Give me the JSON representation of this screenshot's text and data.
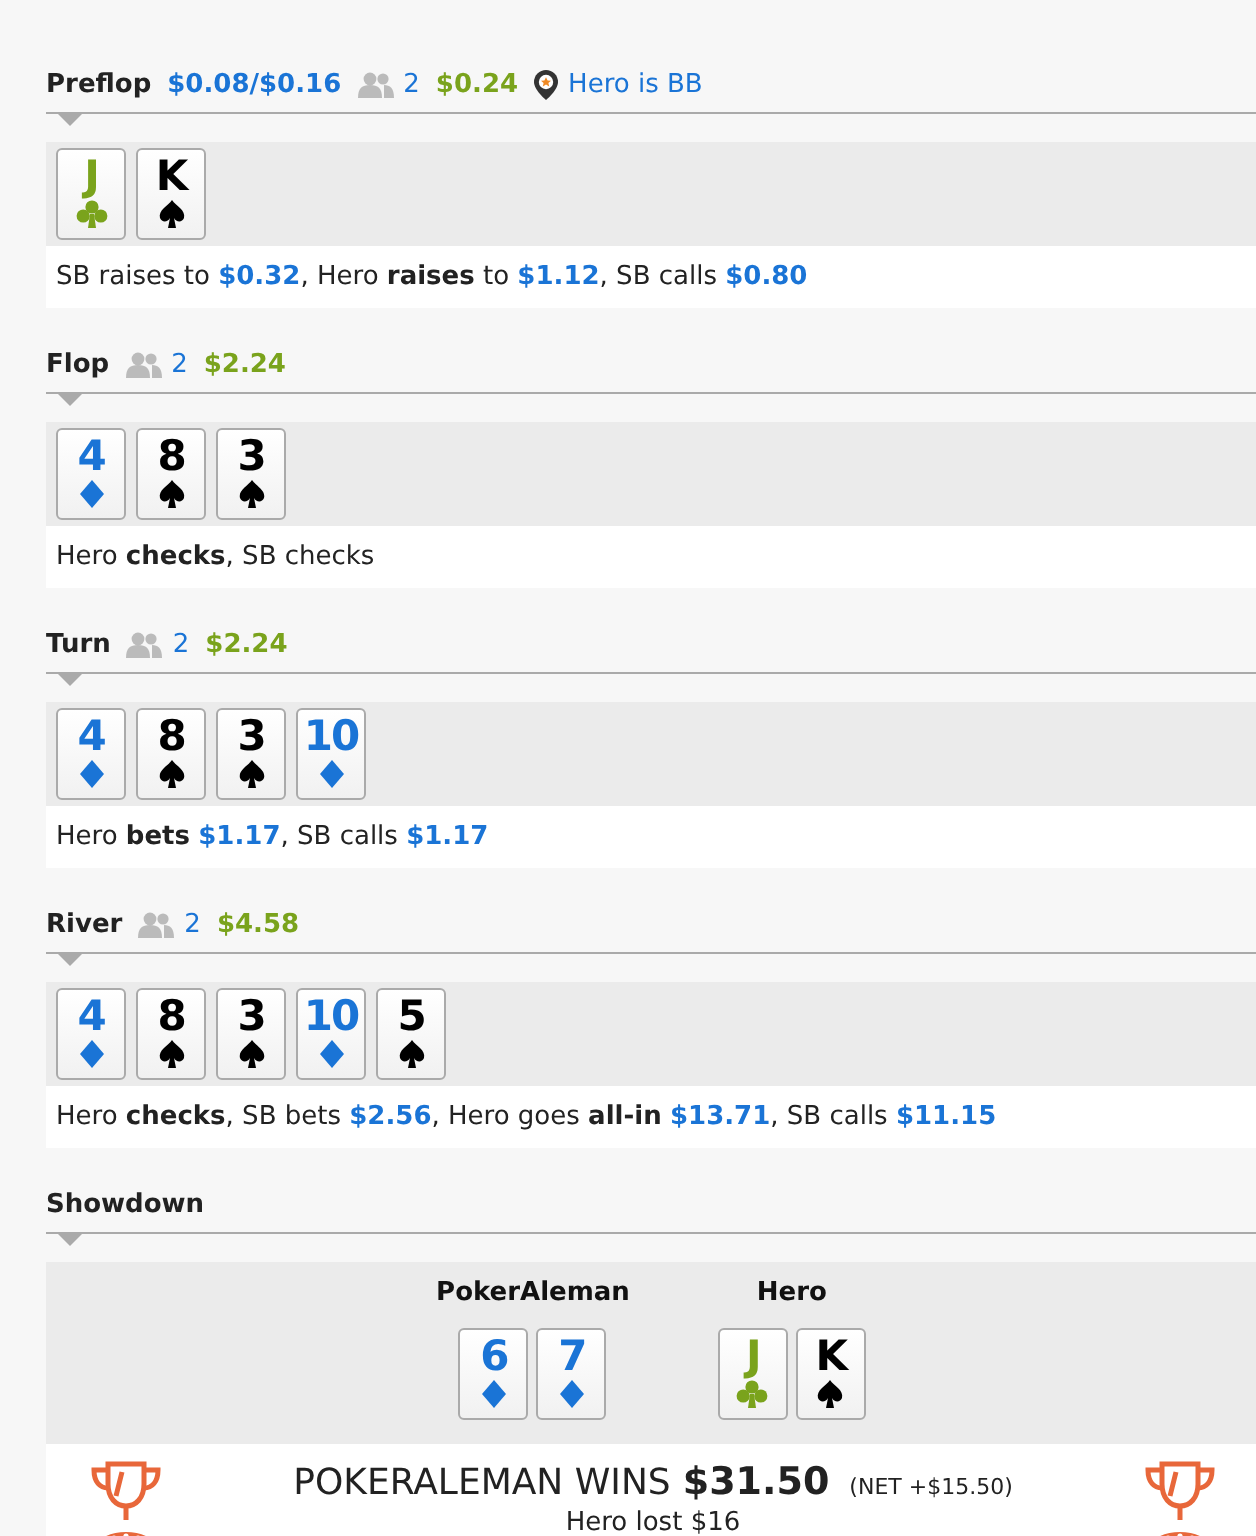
{
  "streets": [
    {
      "name": "Preflop",
      "blinds": "$0.08/$0.16",
      "players": "2",
      "pot": "$0.24",
      "position": "Hero is BB",
      "cards": [
        {
          "rank": "J",
          "kind": "clubs"
        },
        {
          "rank": "K",
          "kind": "spades"
        }
      ],
      "action": [
        {
          "kind": "plain",
          "text": "SB raises to "
        },
        {
          "kind": "amount",
          "text": "$0.32"
        },
        {
          "kind": "plain",
          "text": ", Hero "
        },
        {
          "kind": "verb",
          "text": "raises"
        },
        {
          "kind": "plain",
          "text": " to "
        },
        {
          "kind": "amount",
          "text": "$1.12"
        },
        {
          "kind": "plain",
          "text": ", SB calls "
        },
        {
          "kind": "amount",
          "text": "$0.80"
        }
      ]
    },
    {
      "name": "Flop",
      "players": "2",
      "pot": "$2.24",
      "cards": [
        {
          "rank": "4",
          "kind": "diamonds"
        },
        {
          "rank": "8",
          "kind": "spades"
        },
        {
          "rank": "3",
          "kind": "spades"
        }
      ],
      "action": [
        {
          "kind": "plain",
          "text": "Hero "
        },
        {
          "kind": "verb",
          "text": "checks"
        },
        {
          "kind": "plain",
          "text": ", SB checks"
        }
      ]
    },
    {
      "name": "Turn",
      "players": "2",
      "pot": "$2.24",
      "cards": [
        {
          "rank": "4",
          "kind": "diamonds"
        },
        {
          "rank": "8",
          "kind": "spades"
        },
        {
          "rank": "3",
          "kind": "spades"
        },
        {
          "rank": "10",
          "kind": "diamonds"
        }
      ],
      "action": [
        {
          "kind": "plain",
          "text": "Hero "
        },
        {
          "kind": "verb",
          "text": "bets",
          "space_after": true
        },
        {
          "kind": "amount",
          "text": "$1.17"
        },
        {
          "kind": "plain",
          "text": ", SB calls "
        },
        {
          "kind": "amount",
          "text": "$1.17"
        }
      ]
    },
    {
      "name": "River",
      "players": "2",
      "pot": "$4.58",
      "cards": [
        {
          "rank": "4",
          "kind": "diamonds"
        },
        {
          "rank": "8",
          "kind": "spades"
        },
        {
          "rank": "3",
          "kind": "spades"
        },
        {
          "rank": "10",
          "kind": "diamonds"
        },
        {
          "rank": "5",
          "kind": "spades"
        }
      ],
      "action": [
        {
          "kind": "plain",
          "text": "Hero "
        },
        {
          "kind": "verb",
          "text": "checks"
        },
        {
          "kind": "plain",
          "text": ", SB bets "
        },
        {
          "kind": "amount",
          "text": "$2.56"
        },
        {
          "kind": "plain",
          "text": ", Hero goes "
        },
        {
          "kind": "verb",
          "text": "all-in",
          "space_after": true
        },
        {
          "kind": "amount",
          "text": "$13.71"
        },
        {
          "kind": "plain",
          "text": ", SB calls "
        },
        {
          "kind": "amount",
          "text": "$11.15"
        }
      ]
    }
  ],
  "showdown": {
    "title": "Showdown",
    "players": [
      {
        "name": "PokerAleman",
        "cards": [
          {
            "rank": "6",
            "kind": "diamonds"
          },
          {
            "rank": "7",
            "kind": "diamonds"
          }
        ]
      },
      {
        "name": "Hero",
        "cards": [
          {
            "rank": "J",
            "kind": "clubs"
          },
          {
            "rank": "K",
            "kind": "spades"
          }
        ]
      }
    ],
    "winner": "POKERALEMAN WINS",
    "amount": "$31.50",
    "net": "(NET +$15.50)",
    "loss": "Hero lost $16"
  }
}
